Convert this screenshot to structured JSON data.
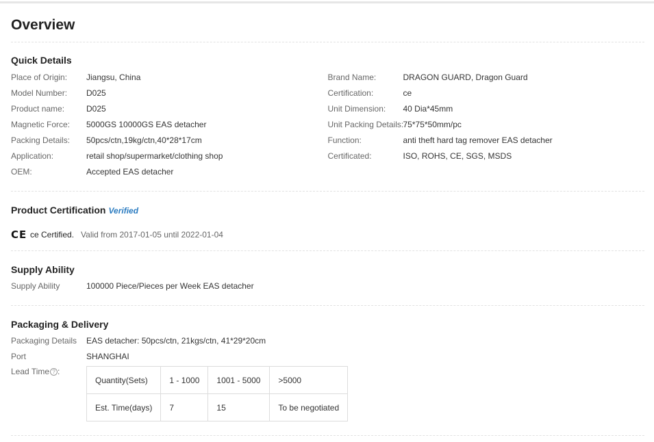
{
  "overview": {
    "title": "Overview"
  },
  "quick_details": {
    "title": "Quick Details",
    "left": [
      {
        "key": "Place of Origin:",
        "value": "Jiangsu, China"
      },
      {
        "key": "Model Number:",
        "value": "D025"
      },
      {
        "key": "Product name:",
        "value": "D025"
      },
      {
        "key": "Magnetic Force:",
        "value": "5000GS 10000GS EAS detacher"
      },
      {
        "key": "Packing Details:",
        "value": "50pcs/ctn,19kg/ctn,40*28*17cm"
      },
      {
        "key": "Application:",
        "value": "retail shop/supermarket/clothing shop"
      },
      {
        "key": "OEM:",
        "value": "Accepted EAS detacher"
      }
    ],
    "right": [
      {
        "key": "Brand Name:",
        "value": "DRAGON GUARD, Dragon Guard"
      },
      {
        "key": "Certification:",
        "value": "ce"
      },
      {
        "key": "Unit Dimension:",
        "value": "40 Dia*45mm"
      },
      {
        "key": "Unit Packing Details:",
        "value": "75*75*50mm/pc"
      },
      {
        "key": "Function:",
        "value": "anti theft hard tag remover EAS detacher"
      },
      {
        "key": "Certificated:",
        "value": "ISO, ROHS, CE, SGS, MSDS"
      }
    ]
  },
  "product_certification": {
    "title": "Product Certification",
    "verified_label": "Verified",
    "ce_mark": "CE",
    "cert_name": "ce Certified.",
    "valid_text": "Valid from 2017-01-05 until 2022-01-04"
  },
  "supply_ability": {
    "title": "Supply Ability",
    "key": "Supply Ability",
    "value": "100000 Piece/Pieces per Week EAS detacher"
  },
  "packaging_delivery": {
    "title": "Packaging & Delivery",
    "packaging_key": "Packaging Details",
    "packaging_value": "EAS detacher: 50pcs/ctn, 21kgs/ctn, 41*29*20cm",
    "port_key": "Port",
    "port_value": "SHANGHAI",
    "lead_key": "Lead Time",
    "help_glyph": "?",
    "lead_table": {
      "header": [
        "Quantity(Sets)",
        "1 - 1000",
        "1001 - 5000",
        ">5000"
      ],
      "row": [
        "Est. Time(days)",
        "7",
        "15",
        "To be negotiated"
      ]
    }
  }
}
